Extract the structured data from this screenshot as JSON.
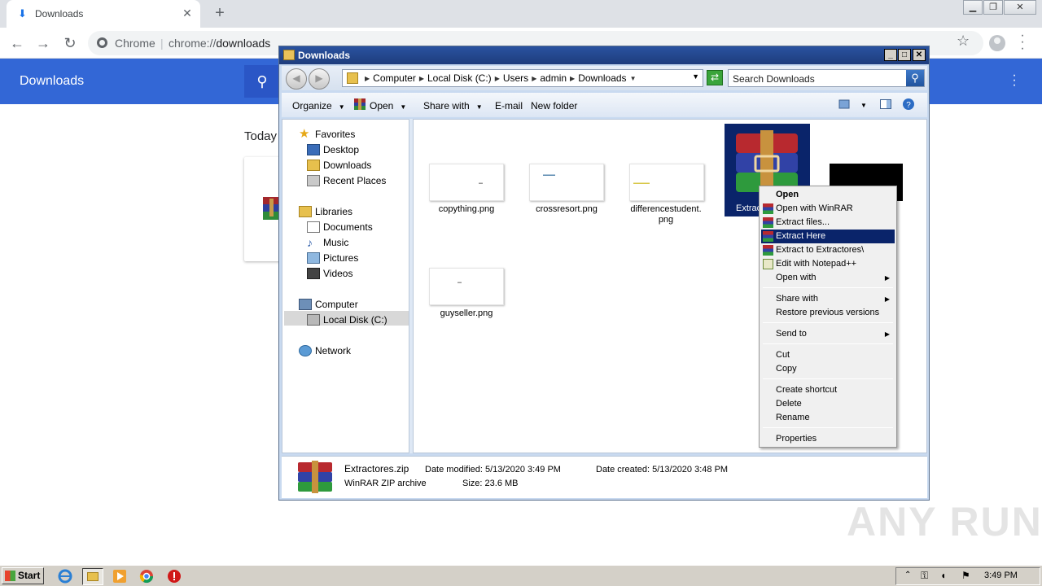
{
  "chrome": {
    "tab_title": "Downloads",
    "omnibox_chip": "Chrome",
    "url_scheme": "chrome://",
    "url_host": "downloads",
    "page_title": "Downloads",
    "section_today": "Today"
  },
  "explorer": {
    "title": "Downloads",
    "breadcrumbs": [
      "Computer",
      "Local Disk (C:)",
      "Users",
      "admin",
      "Downloads"
    ],
    "search_placeholder": "Search Downloads",
    "toolbar": {
      "organize": "Organize",
      "open": "Open",
      "share_with": "Share with",
      "email": "E-mail",
      "new_folder": "New folder"
    },
    "nav": {
      "favorites": "Favorites",
      "desktop": "Desktop",
      "downloads": "Downloads",
      "recent_places": "Recent Places",
      "libraries": "Libraries",
      "documents": "Documents",
      "music": "Music",
      "pictures": "Pictures",
      "videos": "Videos",
      "computer": "Computer",
      "local_disk": "Local Disk (C:)",
      "network": "Network"
    },
    "files": {
      "f1": "copything.png",
      "f2": "crossresort.png",
      "f3a": "differencestudent.",
      "f3b": "png",
      "f4": "guyseller.png",
      "f5_partial": "Extrac",
      "f6_partial": "g"
    },
    "details": {
      "name": "Extractores.zip",
      "type": "WinRAR ZIP archive",
      "date_modified_label": "Date modified:",
      "date_modified": "5/13/2020 3:49 PM",
      "date_created_label": "Date created:",
      "date_created": "5/13/2020 3:48 PM",
      "size_label": "Size:",
      "size": "23.6 MB"
    }
  },
  "context_menu": {
    "open": "Open",
    "open_winrar": "Open with WinRAR",
    "extract_files": "Extract files...",
    "extract_here": "Extract Here",
    "extract_to": "Extract to Extractores\\",
    "edit_npp": "Edit with Notepad++",
    "open_with": "Open with",
    "share_with": "Share with",
    "restore": "Restore previous versions",
    "send_to": "Send to",
    "cut": "Cut",
    "copy": "Copy",
    "create_shortcut": "Create shortcut",
    "delete": "Delete",
    "rename": "Rename",
    "properties": "Properties"
  },
  "taskbar": {
    "start": "Start",
    "clock": "3:49 PM"
  },
  "watermark": "ANY RUN",
  "colors": {
    "chrome_header": "#3367d6",
    "selection": "#0a246a",
    "titlebar": "#1e3c7d"
  }
}
